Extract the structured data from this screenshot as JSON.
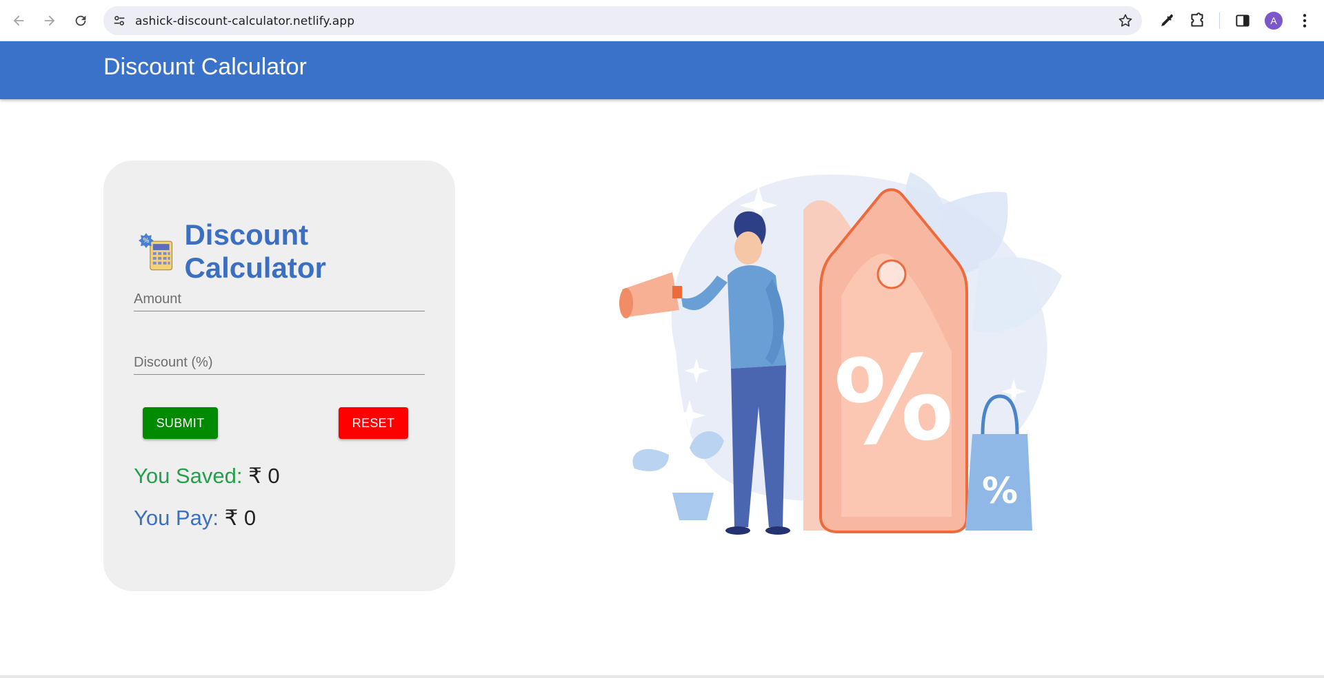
{
  "browser": {
    "url": "ashick-discount-calculator.netlify.app",
    "avatar_letter": "A"
  },
  "appbar": {
    "title": "Discount Calculator"
  },
  "card": {
    "title": "Discount Calculator",
    "amount_placeholder": "Amount",
    "discount_placeholder": "Discount (%)",
    "submit_label": "SUBMIT",
    "reset_label": "RESET",
    "saved_label": "You Saved:",
    "saved_value": "₹ 0",
    "pay_label": "You Pay:",
    "pay_value": "₹ 0"
  },
  "colors": {
    "appbar": "#3b72c9",
    "title_blue": "#3a6fc2",
    "submit": "#008a00",
    "reset": "#ff0000",
    "saved_green": "#22a04a"
  }
}
